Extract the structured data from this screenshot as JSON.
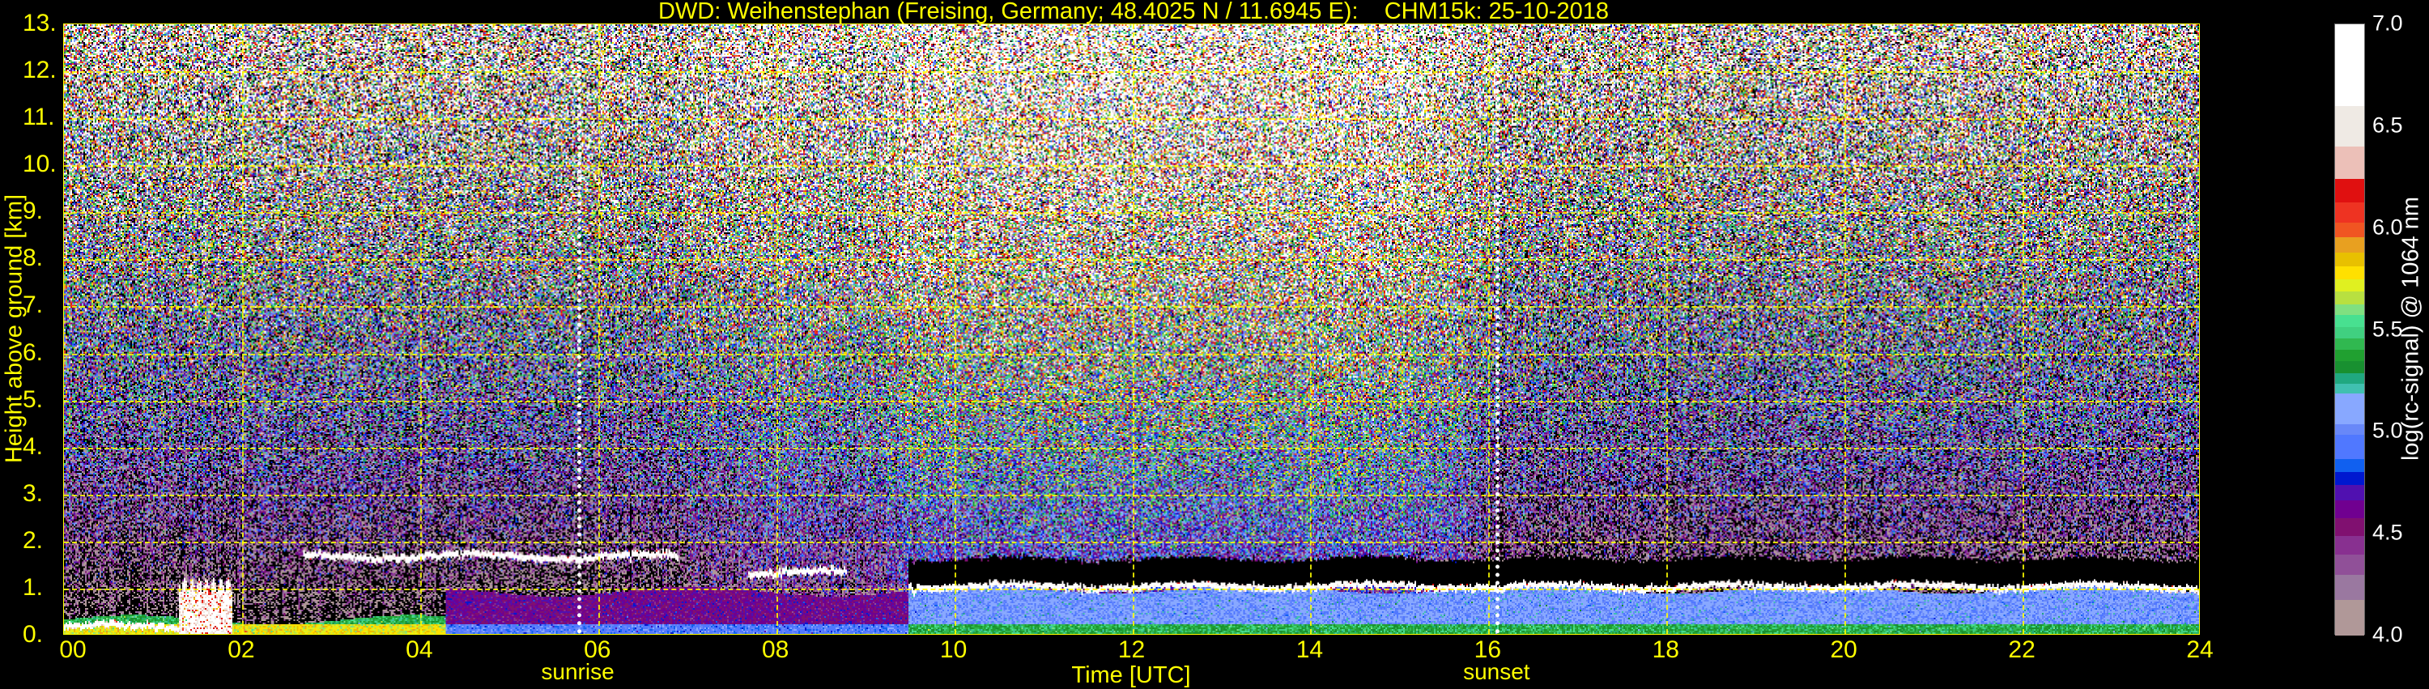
{
  "title": "DWD: Weihenstephan (Freising, Germany; 48.4025 N / 11.6945 E):    CHM15k: 25-10-2018",
  "chart_data": {
    "type": "heatmap",
    "title": "DWD: Weihenstephan (Freising, Germany; 48.4025 N / 11.6945 E):    CHM15k: 25-10-2018",
    "xlabel": "Time [UTC]",
    "ylabel": "Height above ground [km]",
    "xlim": [
      0,
      24
    ],
    "ylim": [
      0,
      13
    ],
    "x_ticks": [
      0,
      2,
      4,
      6,
      8,
      10,
      12,
      14,
      16,
      18,
      20,
      22,
      24
    ],
    "x_tick_labels": [
      "00",
      "02",
      "04",
      "06",
      "08",
      "10",
      "12",
      "14",
      "16",
      "18",
      "20",
      "22",
      "24"
    ],
    "y_ticks": [
      0,
      1,
      2,
      3,
      4,
      5,
      6,
      7,
      8,
      9,
      10,
      11,
      12,
      13
    ],
    "y_tick_labels": [
      "0.",
      "1.",
      "2.",
      "3.",
      "4.",
      "5.",
      "6.",
      "7.",
      "8.",
      "9.",
      "10.",
      "11.",
      "12.",
      "13."
    ],
    "grid": true,
    "annotations": [
      {
        "label": "sunrise",
        "x": 5.78
      },
      {
        "label": "sunset",
        "x": 16.1
      }
    ],
    "colorbar": {
      "label": "log(rc-signal) @ 1064 nm",
      "range": [
        4.0,
        7.0
      ],
      "ticks": [
        4.0,
        4.5,
        5.0,
        5.5,
        6.0,
        6.5,
        7.0
      ],
      "tick_labels": [
        "4.0",
        "4.5",
        "5.0",
        "5.5",
        "6.0",
        "6.5",
        "7.0"
      ],
      "bounds": [
        4.0,
        4.178,
        4.3,
        4.4,
        4.49,
        4.58,
        4.665,
        4.74,
        4.805,
        4.87,
        4.987,
        5.04,
        5.19,
        5.238,
        5.288,
        5.348,
        5.406,
        5.46,
        5.517,
        5.575,
        5.627,
        5.69,
        5.749,
        5.813,
        5.88,
        5.955,
        6.03,
        6.127,
        6.245,
        6.4,
        6.6,
        7.0
      ],
      "colors": [
        "#b09898",
        "#9a78a0",
        "#905098",
        "#883090",
        "#801070",
        "#700090",
        "#5010b0",
        "#0018d0",
        "#1060f0",
        "#5078ff",
        "#6888f8",
        "#88a8ff",
        "#40c0b0",
        "#20a880",
        "#189030",
        "#20a030",
        "#30b850",
        "#40d080",
        "#48e090",
        "#80e080",
        "#b8e040",
        "#e0f020",
        "#ffe000",
        "#e8c000",
        "#e8a020",
        "#f05522",
        "#ee3322",
        "#e01010",
        "#ecc0b8",
        "#efeae4",
        "#ffffff"
      ]
    },
    "cloud_layers": [
      {
        "start": 0.0,
        "end": 1.3,
        "base_km": 0.15
      },
      {
        "start": 1.3,
        "end": 1.9,
        "base_km": 0.0,
        "top_km": 1.2
      },
      {
        "start": 2.7,
        "end": 6.9,
        "base_km": 1.65
      },
      {
        "start": 7.7,
        "end": 8.8,
        "base_km": 1.3
      },
      {
        "start": 9.5,
        "end": 24.0,
        "base_km": 1.0
      }
    ],
    "aerosol_layer": [
      {
        "start": 0.0,
        "end": 4.3,
        "top_km": 0.3,
        "value": 5.4
      },
      {
        "start": 4.3,
        "end": 9.5,
        "top_km": 0.9,
        "value": 4.6
      },
      {
        "start": 9.5,
        "end": 24.0,
        "top_km": 0.95,
        "value": 5.05
      }
    ]
  }
}
